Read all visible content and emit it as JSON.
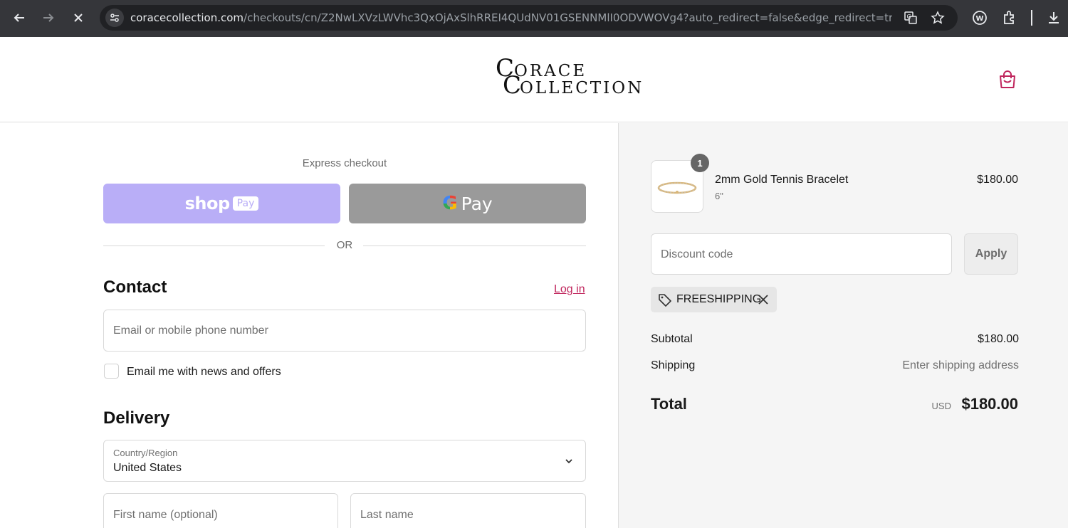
{
  "browser": {
    "url_host": "coracecollection.com",
    "url_path": "/checkouts/cn/Z2NwLXVzLWVhc3QxOjAxSlhRREI4QUdNV01GSENNMlI0ODVWOVg4?auto_redirect=false&edge_redirect=true..."
  },
  "brand": {
    "logo_line1_initial": "C",
    "logo_line1_rest": "ORACE",
    "logo_line2_initial": "C",
    "logo_line2_rest": "OLLECTION",
    "accent_color": "#c0265d"
  },
  "express": {
    "label": "Express checkout",
    "shop_pay_word": "shop",
    "shop_pay_badge": "Pay",
    "gpay_letter": "G",
    "gpay_word": "Pay",
    "or_label": "OR"
  },
  "contact": {
    "heading": "Contact",
    "login_link": "Log in",
    "email_placeholder": "Email or mobile phone number",
    "newsletter_label": "Email me with news and offers"
  },
  "delivery": {
    "heading": "Delivery",
    "country_label": "Country/Region",
    "country_value": "United States",
    "first_name_placeholder": "First name (optional)",
    "last_name_placeholder": "Last name"
  },
  "order": {
    "item": {
      "quantity": "1",
      "name": "2mm Gold Tennis Bracelet",
      "variant": "6\"",
      "price": "$180.00"
    },
    "discount_placeholder": "Discount code",
    "apply_label": "Apply",
    "applied_code": "FREESHIPPING",
    "subtotal_label": "Subtotal",
    "subtotal_value": "$180.00",
    "shipping_label": "Shipping",
    "shipping_value": "Enter shipping address",
    "total_label": "Total",
    "currency": "USD",
    "total_value": "$180.00"
  }
}
